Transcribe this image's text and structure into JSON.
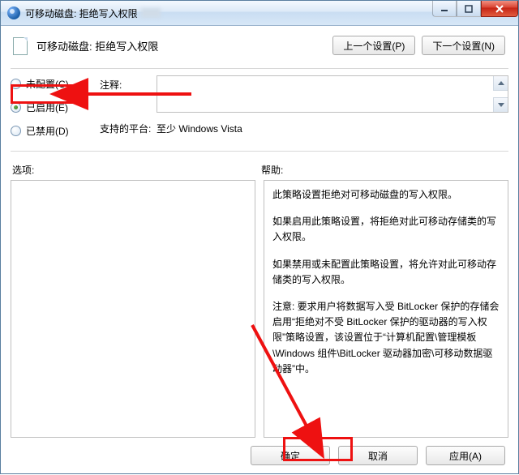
{
  "titlebar": {
    "title": "可移动磁盘: 拒绝写入权限"
  },
  "header": {
    "title": "可移动磁盘: 拒绝写入权限"
  },
  "nav": {
    "prev": "上一个设置(P)",
    "next": "下一个设置(N)"
  },
  "radios": {
    "not_configured": "未配置(C)",
    "enabled": "已启用(E)",
    "disabled": "已禁用(D)"
  },
  "fields": {
    "comment_label": "注释:",
    "platform_label": "支持的平台:",
    "platform_value": "至少 Windows Vista"
  },
  "sections": {
    "options": "选项:",
    "help": "帮助:"
  },
  "help": {
    "p1": "此策略设置拒绝对可移动磁盘的写入权限。",
    "p2": "如果启用此策略设置，将拒绝对此可移动存储类的写入权限。",
    "p3": "如果禁用或未配置此策略设置，将允许对此可移动存储类的写入权限。",
    "p4": "注意: 要求用户将数据写入受 BitLocker 保护的存储会启用“拒绝对不受 BitLocker 保护的驱动器的写入权限”策略设置，该设置位于“计算机配置\\管理模板\\Windows 组件\\BitLocker 驱动器加密\\可移动数据驱动器”中。"
  },
  "footer": {
    "ok": "确定",
    "cancel": "取消",
    "apply": "应用(A)"
  }
}
